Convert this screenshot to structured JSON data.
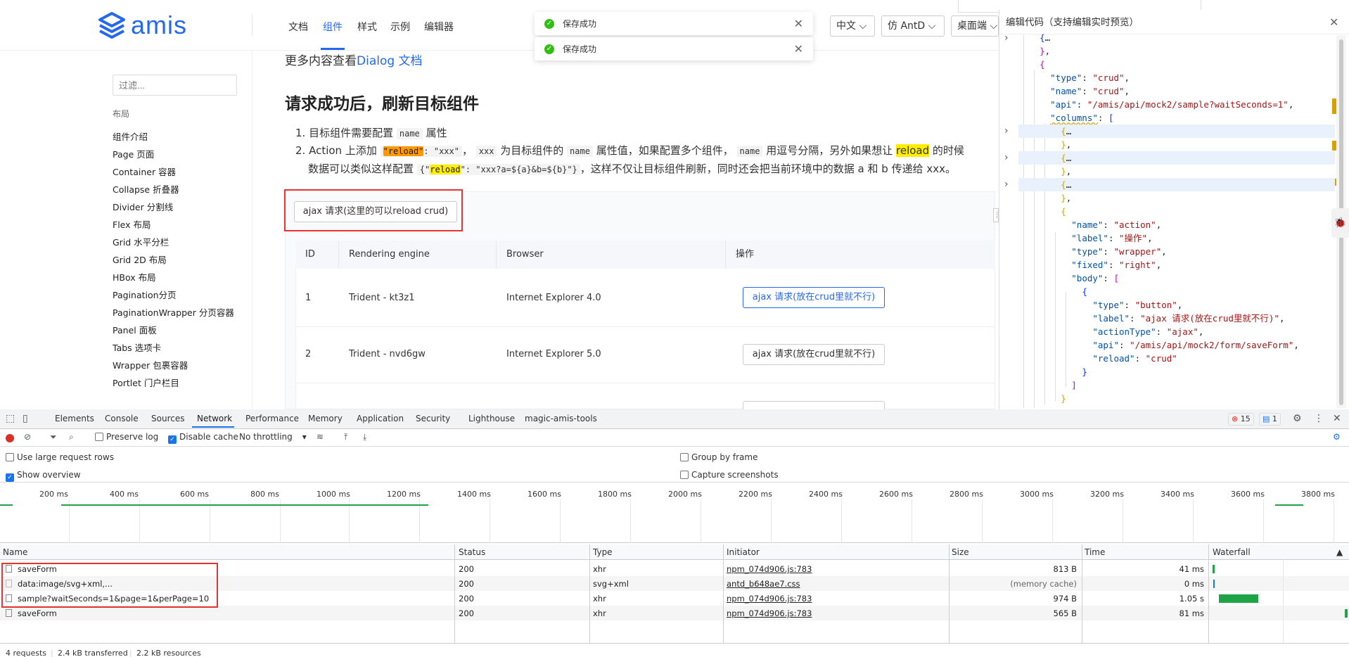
{
  "header": {
    "logo_text": "amis",
    "nav": [
      "文档",
      "组件",
      "样式",
      "示例",
      "编辑器"
    ],
    "active_nav": "组件",
    "lang": "中文",
    "theme": "仿 AntD",
    "mode": "桌面端"
  },
  "toasts": [
    "保存成功",
    "保存成功"
  ],
  "sidebar": {
    "filter_placeholder": "过滤...",
    "category": "布局",
    "items": [
      "组件介绍",
      "Page 页面",
      "Container 容器",
      "Collapse 折叠器",
      "Divider 分割线",
      "Flex 布局",
      "Grid 水平分栏",
      "Grid 2D 布局",
      "HBox 布局",
      "Pagination分页",
      "PaginationWrapper 分页容器",
      "Panel 面板",
      "Tabs 选项卡",
      "Wrapper 包裹容器",
      "Portlet 门户栏目"
    ]
  },
  "content": {
    "more_prefix": "更多内容查看",
    "more_link": "Dialog 文档",
    "section_title": "请求成功后，刷新目标组件",
    "li1_a": "1. 目标组件需要配置",
    "li1_code": "name",
    "li1_b": "属性",
    "li2_a": "2. Action 上添加",
    "li2_code1": "\"reload\"",
    "li2_code1_suffix": ": \"xxx\"",
    "li2_b": "，",
    "li2_code2": "xxx",
    "li2_c": "为目标组件的",
    "li2_code3": "name",
    "li2_d": "属性值，如果配置多个组件，",
    "li2_code4": "name",
    "li2_e": "用逗号分隔，另外如果想让",
    "li2_reload": "reload",
    "li2_f": "的时候",
    "li2_line2_a": "数据可以类似这样配置",
    "li2_line2_code_a": "{\"",
    "li2_line2_code_hl": "reload",
    "li2_line2_code_b": "\": \"xxx?a=${a}&b=${b}\"}",
    "li2_line2_b": "，这样不仅让目标组件刷新，同时还会把当前环境中的数据 a 和 b 传递给 xxx。"
  },
  "demo": {
    "button_label": "ajax 请求(这里的可以reload crud)",
    "columns": [
      "ID",
      "Rendering engine",
      "Browser",
      "操作"
    ],
    "rows": [
      {
        "id": "1",
        "engine": "Trident - kt3z1",
        "browser": "Internet Explorer 4.0",
        "action": "ajax 请求(放在crud里就不行)"
      },
      {
        "id": "2",
        "engine": "Trident - nvd6gw",
        "browser": "Internet Explorer 5.0",
        "action": "ajax 请求(放在crud里就不行)"
      }
    ]
  },
  "editor": {
    "title": "编辑代码（支持编辑实时预览）"
  },
  "devtools": {
    "tabs": [
      "Elements",
      "Console",
      "Sources",
      "Network",
      "Performance",
      "Memory",
      "Application",
      "Security",
      "Lighthouse",
      "magic-amis-tools"
    ],
    "active_tab": "Network",
    "errors": "15",
    "messages": "1",
    "toolbar": {
      "preserve_log": "Preserve log",
      "disable_cache": "Disable cache",
      "throttling": "No throttling"
    },
    "options": {
      "large_rows": "Use large request rows",
      "show_overview": "Show overview",
      "group_by_frame": "Group by frame",
      "capture_screenshots": "Capture screenshots"
    },
    "ticks": [
      "200 ms",
      "400 ms",
      "600 ms",
      "800 ms",
      "1000 ms",
      "1200 ms",
      "1400 ms",
      "1600 ms",
      "1800 ms",
      "2000 ms",
      "2200 ms",
      "2400 ms",
      "2600 ms",
      "2800 ms",
      "3000 ms",
      "3200 ms",
      "3400 ms",
      "3600 ms",
      "3800 ms"
    ],
    "columns": [
      "Name",
      "Status",
      "Type",
      "Initiator",
      "Size",
      "Time",
      "Waterfall"
    ],
    "requests": [
      {
        "name": "saveForm",
        "status": "200",
        "type": "xhr",
        "initiator": "npm_074d906.js:783",
        "size": "813 B",
        "time": "41 ms"
      },
      {
        "name": "data:image/svg+xml,...",
        "status": "200",
        "type": "svg+xml",
        "initiator": "antd_b648ae7.css",
        "size": "(memory cache)",
        "time": "0 ms"
      },
      {
        "name": "sample?waitSeconds=1&page=1&perPage=10",
        "status": "200",
        "type": "xhr",
        "initiator": "npm_074d906.js:783",
        "size": "974 B",
        "time": "1.05 s"
      },
      {
        "name": "saveForm",
        "status": "200",
        "type": "xhr",
        "initiator": "npm_074d906.js:783",
        "size": "565 B",
        "time": "81 ms"
      }
    ],
    "status_bar": [
      "4 requests",
      "2.4 kB transferred",
      "2.2 kB resources"
    ]
  }
}
